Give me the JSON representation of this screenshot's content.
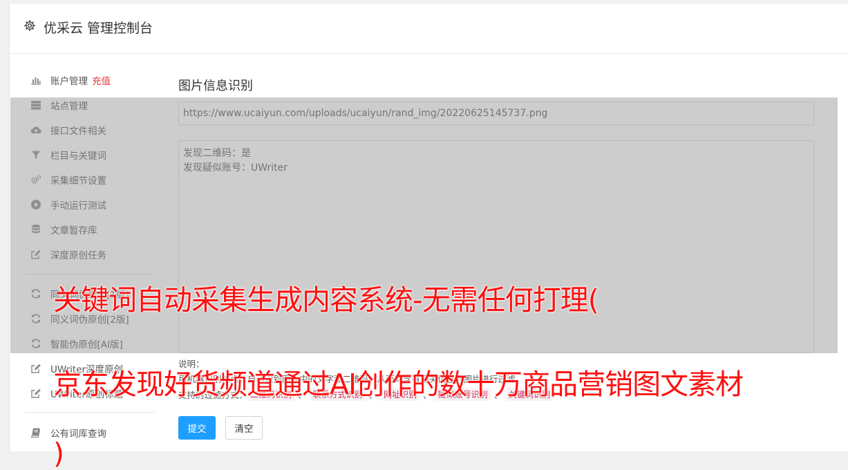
{
  "header": {
    "title": "优采云 管理控制台",
    "icon": "gear-icon"
  },
  "sidebar": {
    "items": [
      {
        "label": "账户管理",
        "extra": "充值",
        "icon": "bar-chart-icon"
      },
      {
        "label": "站点管理",
        "icon": "server-icon"
      },
      {
        "label": "接口文件相关",
        "icon": "cloud-upload-icon"
      },
      {
        "label": "栏目与关键词",
        "icon": "filter-icon"
      },
      {
        "label": "采集细节设置",
        "icon": "cogs-icon"
      },
      {
        "label": "手动运行测试",
        "icon": "play-circle-icon"
      },
      {
        "label": "文章暂存库",
        "icon": "database-icon"
      },
      {
        "label": "深度原创任务",
        "icon": "edit-icon"
      },
      {
        "label": "同义词伪原创[1版]",
        "icon": "refresh-icon"
      },
      {
        "label": "同义词伪原创[2版]",
        "icon": "refresh-icon"
      },
      {
        "label": "智能伪原创[AI版]",
        "icon": "refresh-icon"
      },
      {
        "label": "UWriter深度原创",
        "icon": "edit-icon"
      },
      {
        "label": "UWriter原创标题",
        "icon": "edit-icon"
      },
      {
        "label": "公有词库查询",
        "icon": "book-icon"
      }
    ]
  },
  "main": {
    "page_title": "图片信息识别",
    "url_value": "https://www.ucaiyun.com/uploads/ucaiyun/rand_img/20220625145737.png",
    "result_lines": [
      "发现二维码：是",
      "发现疑似账号：UWriter"
    ],
    "note_label": "说明：",
    "note_text": "用机器识别技术，自动识别图片中的文字和二维码，从而对含有相关信息的图片进行过滤。",
    "filter_label": "支持的过滤方式：",
    "filters": [
      "二维码识别",
      "联系方式识别",
      "网址识别",
      "疑似账号识别",
      "关键词识别"
    ],
    "filter_sep": "、",
    "submit_label": "提交",
    "clear_label": "清空"
  },
  "overlay_text": {
    "line1": "关键词自动采集生成内容系统-无需任何打理(",
    "line2": "京东发现好货频道通过AI创作的数十万商品营销图文素材",
    "line3": ")"
  },
  "colors": {
    "primary_button": "#1e9fff",
    "recharge": "#e4393c",
    "caption": "#ff1010",
    "tag_text": "#c7254e"
  }
}
